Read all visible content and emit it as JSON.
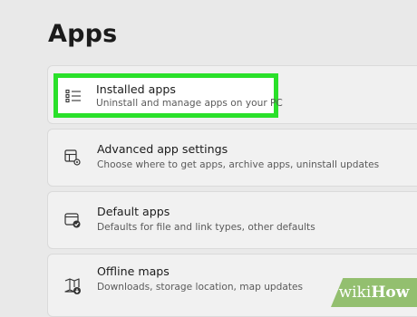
{
  "page": {
    "title": "Apps"
  },
  "items": [
    {
      "title": "Installed apps",
      "subtitle": "Uninstall and manage apps on your PC",
      "icon": "list-icon",
      "highlighted": true
    },
    {
      "title": "Advanced app settings",
      "subtitle": "Choose where to get apps, archive apps, uninstall updates",
      "icon": "app-settings-icon"
    },
    {
      "title": "Default apps",
      "subtitle": "Defaults for file and link types, other defaults",
      "icon": "default-apps-icon"
    },
    {
      "title": "Offline maps",
      "subtitle": "Downloads, storage location, map updates",
      "icon": "map-download-icon"
    }
  ],
  "watermark": {
    "prefix": "wiki",
    "suffix": "How"
  },
  "colors": {
    "highlight": "#2ae02a",
    "watermark_bg": "#93bf6f"
  }
}
